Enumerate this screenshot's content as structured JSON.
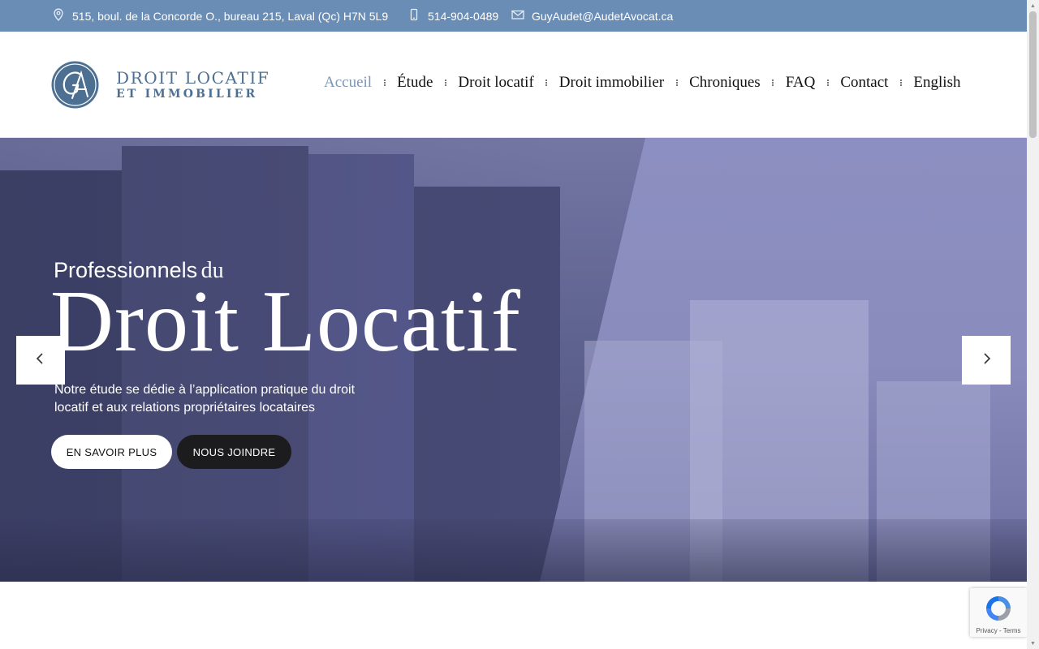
{
  "topbar": {
    "address": "515, boul. de la Concorde O., bureau 215, Laval (Qc) H7N 5L9",
    "phone": "514-904-0489",
    "email": "GuyAudet@AudetAvocat.ca",
    "background_color": "#6a8db5"
  },
  "logo": {
    "line1": "DROIT LOCATIF",
    "line2": "ET IMMOBILIER",
    "monogram": "GA",
    "color": "#4d6f92"
  },
  "nav": {
    "items": [
      {
        "label": "Accueil",
        "active": true
      },
      {
        "label": "Étude",
        "active": false
      },
      {
        "label": "Droit locatif",
        "active": false
      },
      {
        "label": "Droit immobilier",
        "active": false
      },
      {
        "label": "Chroniques",
        "active": false
      },
      {
        "label": "FAQ",
        "active": false
      },
      {
        "label": "Contact",
        "active": false
      },
      {
        "label": "English",
        "active": false
      }
    ],
    "active_color": "#7d96b5"
  },
  "hero": {
    "subtitle_part1": "Professionnels",
    "subtitle_part2": "du",
    "title": "Droit Locatif",
    "description": "Notre étude se dédie à l’application pratique du droit locatif et aux relations propriétaires locataires",
    "buttons": {
      "more": "EN SAVOIR PLUS",
      "join": "NOUS JOINDRE"
    }
  },
  "recaptcha": {
    "links": "Privacy - Terms"
  }
}
